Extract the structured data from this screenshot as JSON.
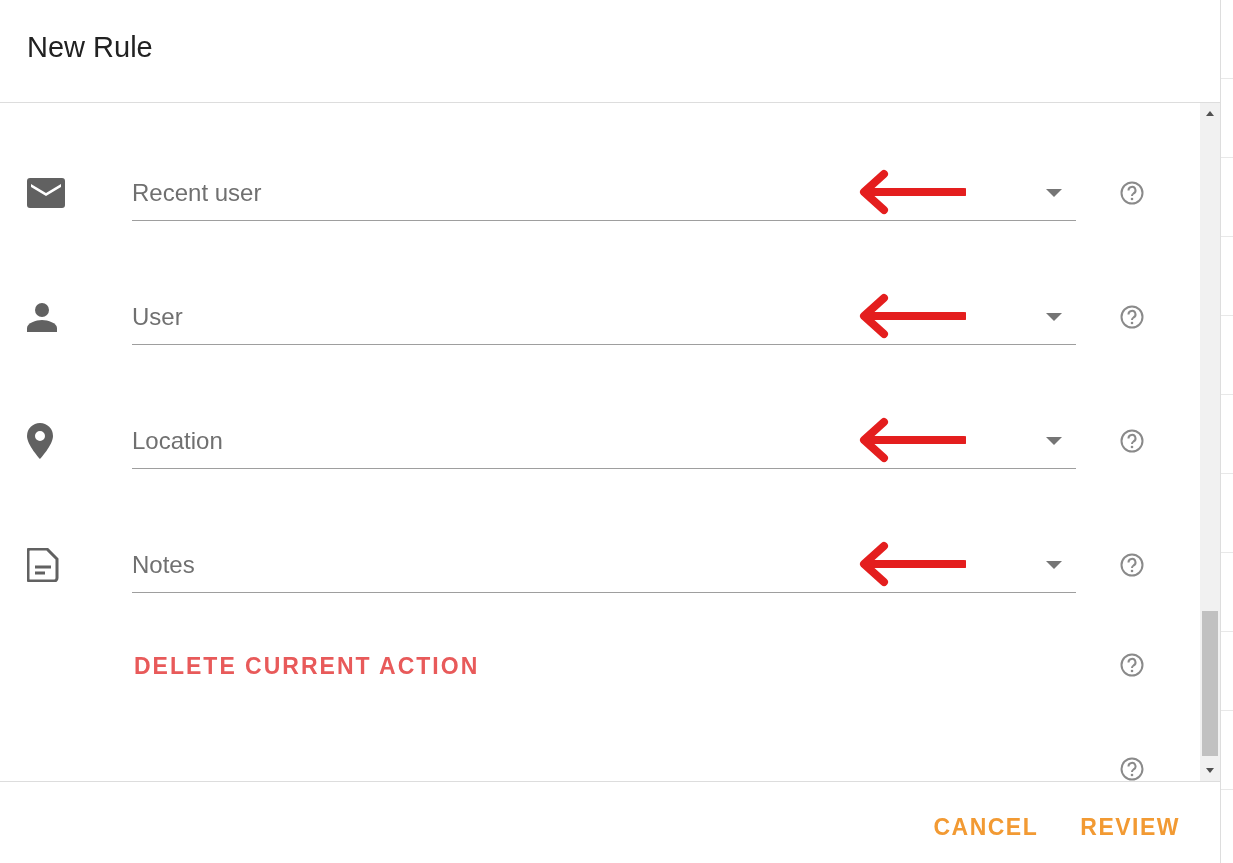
{
  "dialog": {
    "title": "New Rule"
  },
  "fields": [
    {
      "kind": "mail",
      "placeholder": "Recent user",
      "arrow": true
    },
    {
      "kind": "person",
      "placeholder": "User",
      "arrow": true
    },
    {
      "kind": "place",
      "placeholder": "Location",
      "arrow": true
    },
    {
      "kind": "note",
      "placeholder": "Notes",
      "arrow": true
    }
  ],
  "delete_button": "DELETE CURRENT ACTION",
  "buttons": [
    {
      "label": "CANCEL"
    },
    {
      "label": "REVIEW"
    }
  ]
}
